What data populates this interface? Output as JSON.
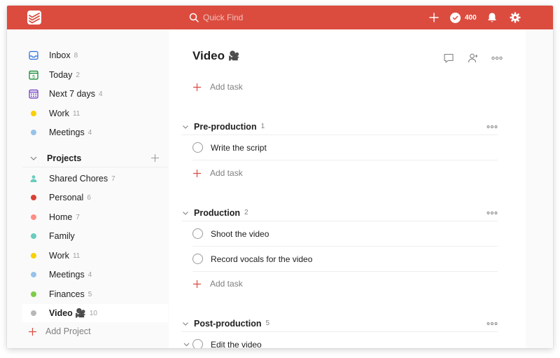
{
  "topbar": {
    "search_placeholder": "Quick Find",
    "karma_value": "400",
    "bg_color": "#db4c3f"
  },
  "sidebar": {
    "items": [
      {
        "label": "Inbox",
        "count": "8",
        "icon": "inbox-icon",
        "color": "#246fe0"
      },
      {
        "label": "Today",
        "count": "2",
        "icon": "calendar-today-icon",
        "day": "5",
        "color": "#058527"
      },
      {
        "label": "Next 7 days",
        "count": "4",
        "icon": "calendar-week-icon",
        "color": "#692fc2"
      },
      {
        "label": "Work",
        "count": "11",
        "icon": "dot",
        "color": "#fad000"
      },
      {
        "label": "Meetings",
        "count": "4",
        "icon": "dot",
        "color": "#96c3eb"
      }
    ],
    "projects_header": "Projects",
    "projects": [
      {
        "label": "Shared Chores",
        "count": "7",
        "icon": "shared-user-icon",
        "color": "#6accbc"
      },
      {
        "label": "Personal",
        "count": "6",
        "color": "#db4035"
      },
      {
        "label": "Home",
        "count": "7",
        "color": "#ff8d85"
      },
      {
        "label": "Family",
        "count": "",
        "color": "#6accbc"
      },
      {
        "label": "Work",
        "count": "11",
        "color": "#fad000"
      },
      {
        "label": "Meetings",
        "count": "4",
        "color": "#96c3eb"
      },
      {
        "label": "Finances",
        "count": "5",
        "color": "#7ecc49"
      },
      {
        "label": "Video 🎥",
        "count": "10",
        "color": "#b8b8b8",
        "active": true
      }
    ],
    "add_project": "Add Project"
  },
  "main": {
    "title": "Video",
    "title_emoji": "🎥",
    "add_task": "Add task",
    "sections": [
      {
        "title": "Pre-production",
        "count": "1",
        "tasks": [
          "Write the script"
        ]
      },
      {
        "title": "Production",
        "count": "2",
        "tasks": [
          "Shoot the video",
          "Record vocals for the video"
        ]
      },
      {
        "title": "Post-production",
        "count": "5",
        "tasks": [
          "Edit the video"
        ]
      }
    ]
  },
  "colors": {
    "accent": "#db4c3f",
    "sidebar_bg": "#fafafa"
  }
}
